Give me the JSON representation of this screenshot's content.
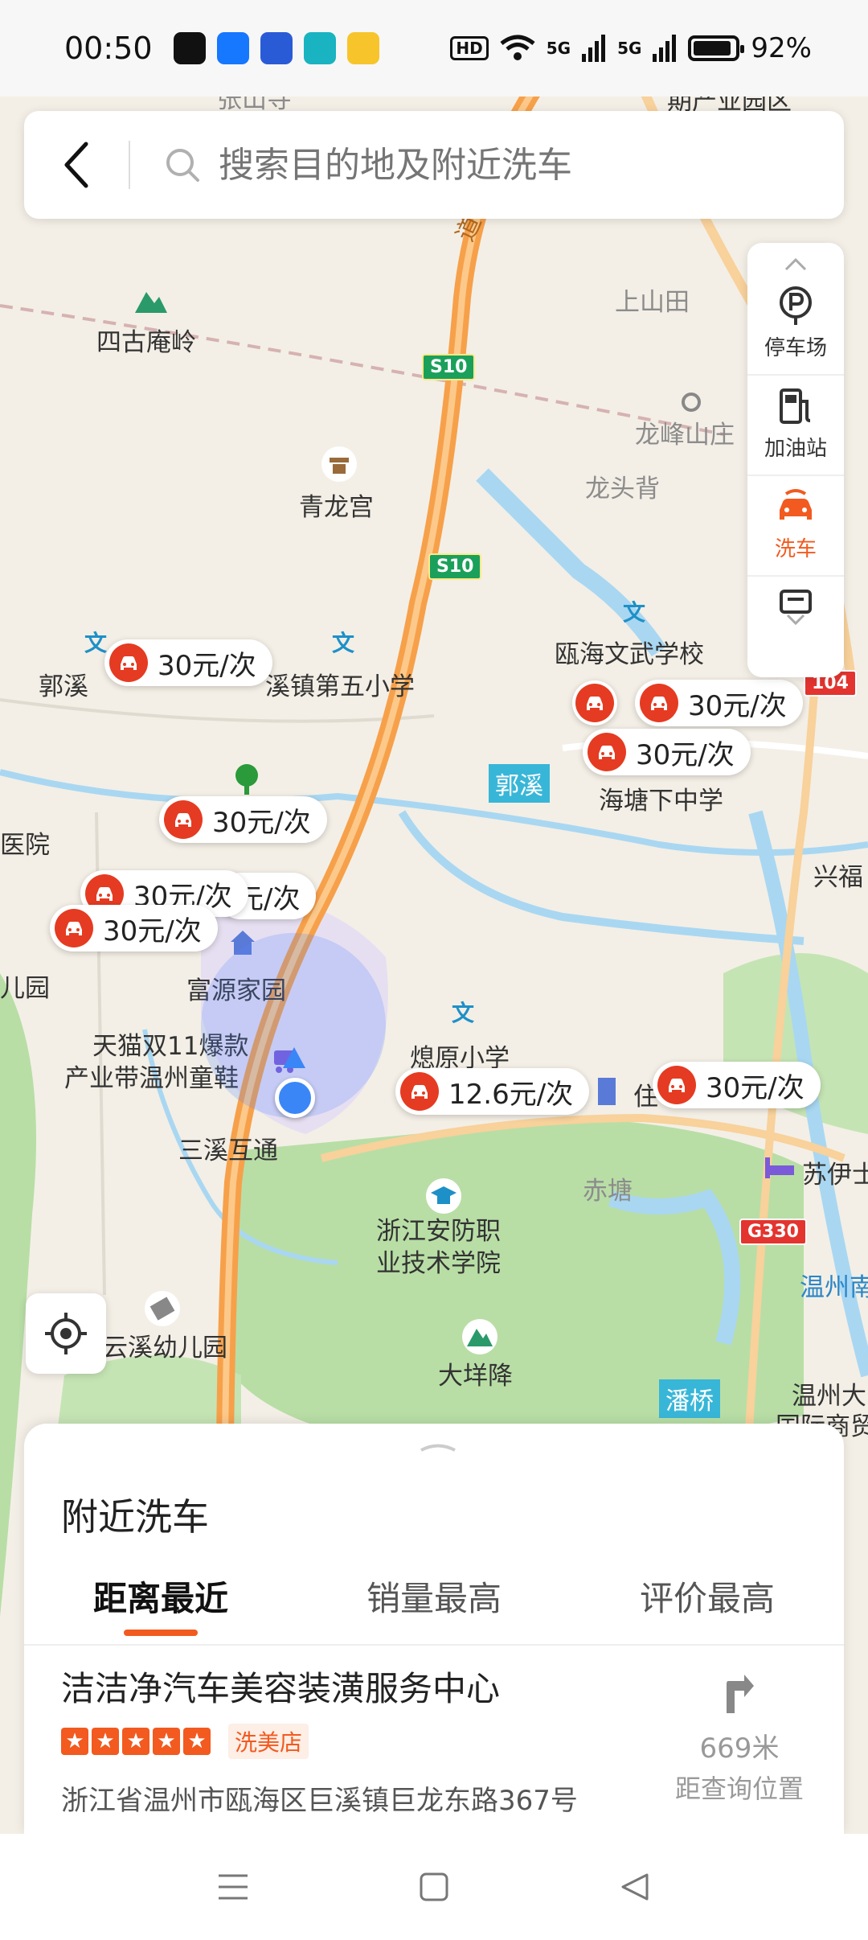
{
  "status_bar": {
    "time": "00:50",
    "hd_label": "HD",
    "sig1": "5G",
    "sig2": "5G",
    "battery_text": "92%",
    "battery_level": 0.92,
    "app_icons": [
      {
        "name": "tiktok-app-icon",
        "color": "#111111"
      },
      {
        "name": "alipay-app-icon",
        "color": "#1677ff"
      },
      {
        "name": "baidu-app-icon",
        "color": "#2a5bd7"
      },
      {
        "name": "camel-app-icon",
        "color": "#19b3c2"
      },
      {
        "name": "coupon-app-icon",
        "color": "#f7c52b"
      }
    ]
  },
  "search": {
    "placeholder": "搜索目的地及附近洗车"
  },
  "side_panel": {
    "items": [
      {
        "label": "停车场",
        "icon": "parking-icon"
      },
      {
        "label": "加油站",
        "icon": "gas-station-icon"
      },
      {
        "label": "洗车",
        "icon": "car-wash-icon",
        "active": true
      },
      {
        "label": "",
        "icon": "service-area-icon"
      }
    ]
  },
  "map": {
    "labels": {
      "zhangshan": "张山寺",
      "industrial": "期产业园区",
      "sigu": "四古庵岭",
      "shangshan": "上山田",
      "longfeng": "龙峰山庄",
      "longtou": "龙头背",
      "qinglong": "青龙宫",
      "ouhai_school": "瓯海文武学校",
      "guoxi1": "郭溪",
      "xizhen": "溪镇第五小学",
      "haitang": "海塘下中学",
      "yiyuan": "医院",
      "xingfu": "兴福",
      "fuyuan": "富源家园",
      "eryuan": "儿园",
      "tmall1": "天猫双11爆款",
      "tmall2": "产业带温州童鞋",
      "xiaoyuan": "熄原小学",
      "zhu": "住",
      "sanxi": "三溪互通",
      "suyi": "苏伊士",
      "chitang": "赤塘",
      "zhejiang1": "浙江安防职",
      "zhejiang2": "业技术学院",
      "wenzhounan": "温州南",
      "yunxi": "云溪幼儿园",
      "dayang": "大垟降",
      "wenzhouda1": "温州大",
      "wenzhouda2": "国际商贸",
      "guoxi_water": "郭溪",
      "panqiao": "潘桥",
      "s10a": "S10",
      "s10b": "S10",
      "g330": "G330",
      "r104": "104",
      "road_dao": "道"
    },
    "price_pins": [
      {
        "text": "30元/次"
      },
      {
        "text": "30元/次"
      },
      {
        "text": "30元/次"
      },
      {
        "text": "30元/次"
      },
      {
        "text": "元/次"
      },
      {
        "text": "30元/次"
      },
      {
        "text": "30元/次"
      },
      {
        "text": "12.6元/次"
      },
      {
        "text": "30元/次"
      }
    ]
  },
  "sheet": {
    "title": "附近洗车",
    "tabs": [
      "距离最近",
      "销量最高",
      "评价最高"
    ],
    "shop": {
      "name": "洁洁净汽车美容装潢服务中心",
      "rating": 5,
      "star_glyph": "★",
      "tag": "洗美店",
      "address": "浙江省温州市瓯海区巨溪镇巨龙东路367号",
      "distance": "669米",
      "distance_label": "距查询位置"
    }
  },
  "colors": {
    "accent": "#f25a1f",
    "pin_red": "#e53b22",
    "highway": "#f7a04a",
    "water": "#a9d7f2",
    "green": "#b8dea6"
  }
}
